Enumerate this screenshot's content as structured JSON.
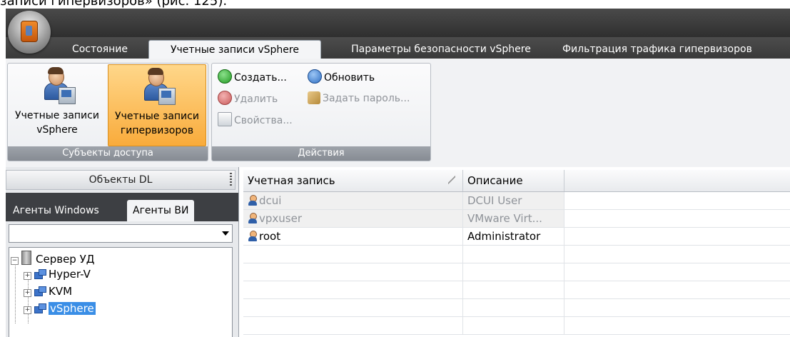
{
  "caption": "записи гипервизоров» (рис. 125).",
  "tabs": [
    {
      "label": "Состояние",
      "active": false
    },
    {
      "label": "Учетные записи vSphere",
      "active": true
    },
    {
      "label": "Параметры безопасности vSphere",
      "active": false
    },
    {
      "label": "Фильтрация трафика гипервизоров",
      "active": false
    }
  ],
  "ribbon": {
    "subjects": {
      "group_label": "Субъекты доступа",
      "vsphere_accounts_label": "Учетные записи vSphere",
      "hypervisor_accounts_label": "Учетные записи гипервизоров"
    },
    "actions": {
      "group_label": "Действия",
      "create": "Создать...",
      "refresh": "Обновить",
      "delete": "Удалить",
      "set_password": "Задать пароль...",
      "properties": "Свойства..."
    }
  },
  "left_pane": {
    "header": "Объекты DL",
    "tabs": [
      "Агенты Windows",
      "Агенты ВИ"
    ],
    "active_tab": "Агенты ВИ",
    "combo_value": "",
    "tree": {
      "root": "Сервер УД",
      "children": [
        "Hyper-V",
        "KVM",
        "vSphere"
      ],
      "selected": "vSphere"
    }
  },
  "grid": {
    "columns": [
      "Учетная запись",
      "Описание"
    ],
    "rows": [
      {
        "account": "dcui",
        "description": "DCUI User",
        "disabled": true
      },
      {
        "account": "vpxuser",
        "description": "VMware Virt...",
        "disabled": true
      },
      {
        "account": "root",
        "description": "Administrator",
        "disabled": false
      }
    ]
  },
  "colors": {
    "selected_button": "#f9ab3b",
    "tree_selection": "#3a8ee6",
    "dark_chrome": "#3b3b3b"
  }
}
